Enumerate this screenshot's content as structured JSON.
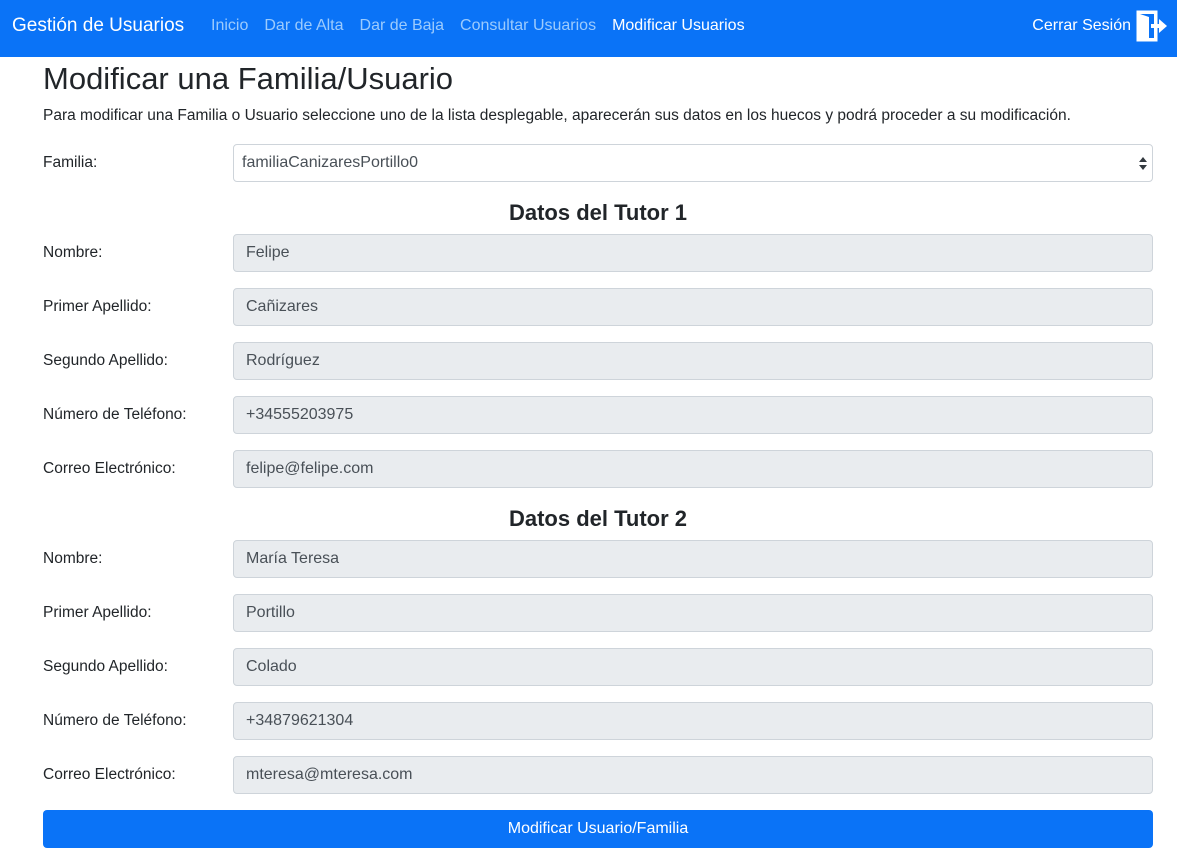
{
  "navbar": {
    "brand": "Gestión de Usuarios",
    "links": [
      "Inicio",
      "Dar de Alta",
      "Dar de Baja",
      "Consultar Usuarios",
      "Modificar Usuarios"
    ],
    "active_link": "Modificar Usuarios",
    "logout_label": "Cerrar Sesión",
    "logout_icon": "logout-door-icon"
  },
  "page": {
    "title": "Modificar una Familia/Usuario",
    "description": "Para modificar una Familia o Usuario seleccione uno de la lista desplegable, aparecerán sus datos en los huecos y podrá proceder a su modificación."
  },
  "family_select": {
    "label": "Familia:",
    "selected": "familiaCanizaresPortillo0"
  },
  "tutor1": {
    "title": "Datos del Tutor 1",
    "fields": [
      {
        "label": "Nombre:",
        "value": "Felipe"
      },
      {
        "label": "Primer Apellido:",
        "value": "Cañizares"
      },
      {
        "label": "Segundo Apellido:",
        "value": "Rodríguez"
      },
      {
        "label": "Número de Teléfono:",
        "value": "+34555203975"
      },
      {
        "label": "Correo Electrónico:",
        "value": "felipe@felipe.com"
      }
    ]
  },
  "tutor2": {
    "title": "Datos del Tutor 2",
    "fields": [
      {
        "label": "Nombre:",
        "value": "María Teresa"
      },
      {
        "label": "Primer Apellido:",
        "value": "Portillo"
      },
      {
        "label": "Segundo Apellido:",
        "value": "Colado"
      },
      {
        "label": "Número de Teléfono:",
        "value": "+34879621304"
      },
      {
        "label": "Correo Electrónico:",
        "value": "mteresa@mteresa.com"
      }
    ]
  },
  "submit_label": "Modificar Usuario/Familia",
  "colors": {
    "primary": "#0a73f7",
    "nav_inactive": "#9ccbfd",
    "field_bg": "#e9ecef"
  }
}
